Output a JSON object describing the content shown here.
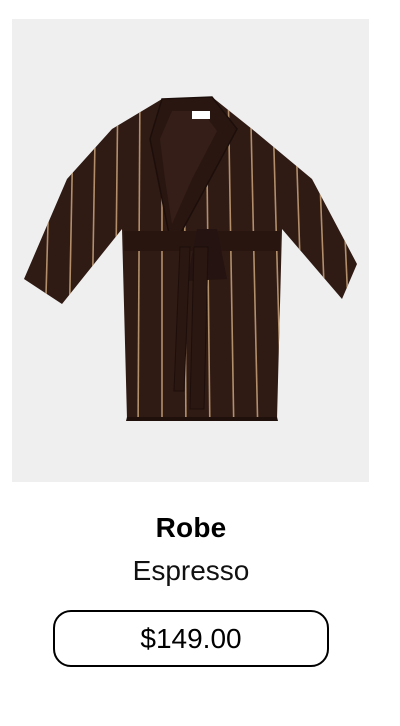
{
  "product": {
    "name": "Robe",
    "variant": "Espresso",
    "price": "$149.00",
    "image_subject": "striped-robe",
    "colors": {
      "robe": "#2f1a14",
      "stripe": "#c9a57a",
      "image_background": "#efefef",
      "label": "#ffffff"
    }
  }
}
